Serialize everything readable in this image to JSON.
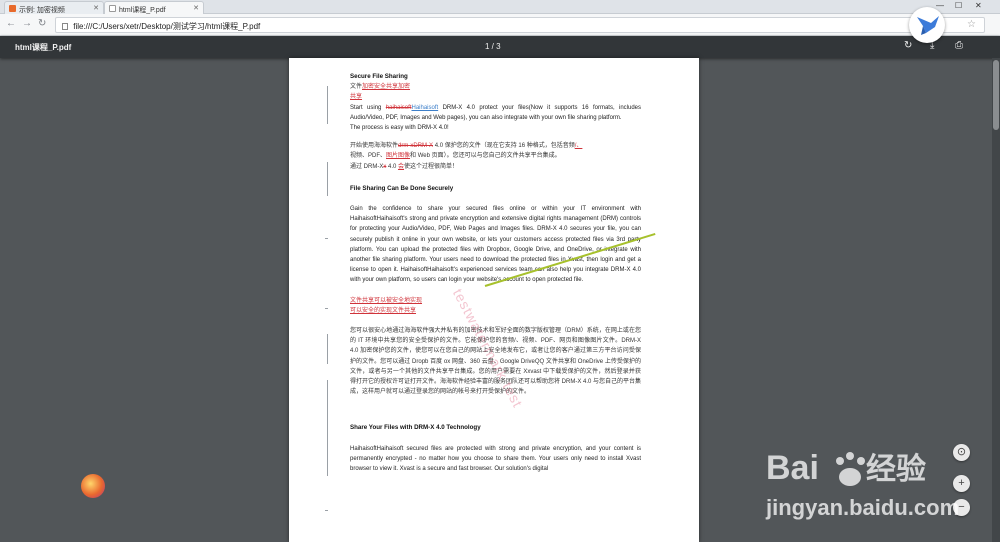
{
  "tabs": [
    {
      "title": "示例: 加密视频",
      "active": false
    },
    {
      "title": "html课程_P.pdf",
      "active": true
    }
  ],
  "address": {
    "url": "file:///C:/Users/xetr/Desktop/测试学习/html课程_P.pdf"
  },
  "pdf": {
    "file_name": "html课程_P.pdf",
    "page_indicator": "1 / 3"
  },
  "doc": {
    "h1": "Secure File Sharing",
    "cn_title_a": "文件",
    "cn_title_b": "加密安全共享加密",
    "cn_title_c": "共享",
    "p1_a": "Start using",
    "p1_strike": "haihaisoft",
    "p1_link": "Haihaisoft",
    "p1_b": "DRM-X 4.0 protect your files(Now it supports 16 formats, includes Audio/Video, PDF, Images and Web pages), you can also integrate with your own file sharing platform.",
    "p1_c": "The process is easy with DRM-X 4.0!",
    "cn1": "开始使用海海软件",
    "cn1_red": "drm-xDRM-X",
    "cn1_b": "4.0 保护您的文件（现在它支持 16 种格式，包括音频",
    "cn1_red2": "/、",
    "cn1_c": "视频、PDF、",
    "cn1_red3": "图片图像",
    "cn1_d": "和 Web 页面）。您还可以与您自己的文件共享平台集成。",
    "cn1_e": "通过 DRM-X",
    "cn1_red4": "x",
    "cn1_f": " 4.0 ",
    "cn1_red5": "会",
    "cn1_g": "使这个过程很简单！",
    "h2": "File Sharing Can Be Done Securely",
    "p2": "Gain the confidence to share your secured files online or within your IT environment with HaihaisoftHaihaisoft's strong and private encryption and extensive digital rights management (DRM) controls for protecting your Audio/Video, PDF, Web Pages and Images files. DRM-X 4.0 secures your file, you can securely publish it online in your own website, or lets your customers access protected files via 3rd party platform. You can upload the protected files with Dropbox, Google Drive, and OneDrive, or integrate with another file sharing platform. Your users need to download the protected files in Xvast, then login and get a license to open it. HaihaisoftHaihaisoft's experienced services team can also help you integrate DRM-X 4.0 with your own platform, so users can login your website's account to open protected file.",
    "cn2_t1": "文件共享可以被安全地实现",
    "cn2_t2": "可以安全的实现文件共享",
    "cn2": "您可以很安心地通过海海软件强大并私有的加密技术和军好全面的数字版权管理（DRM）系统，在网上或在您的 IT 环境中共享您的安全受保护的文件。它能保护您的音频/、视频、PDF、网页和图像图片文件。DRM-X 4.0 加密保护您的文件，使您可以在您自己的网站上安全地发布它，或者让您的客户通过第三方平台访问受保护的文件。您可以通过 Dropb 百度 ox 网盘、360 云盘、Google DriveQQ 文件共享和 OneDrive 上传受保护的文件，或者与另一个其他的文件共享平台集成。您的用户需要在 Xxvast 中下载受保护的文件，然后登录并获得打开它的授权许可证打开文件。海海软件经验丰富的服务团队还可以帮助您将 DRM-X 4.0 与您自己的平台集成，这样用户就可以通过登录您的网站的帐号来打开受保护的文件。",
    "h3": "Share Your Files with DRM-X 4.0 Technology",
    "p3": "HaihaisoftHaihaisoft secured files are protected with strong and private encryption, and your content is permanently encrypted - no matter how you choose to share them. Your users only need to install Xvast browser to view it. Xvast is a secure and fast browser. Our solution's digital",
    "watermark": "testwatermark test",
    "strike_words": [
      "haihaisoft",
      "drm-x",
      "x",
      "ox"
    ]
  },
  "zoom": {
    "fit": "⊙",
    "plus": "+",
    "minus": "−"
  },
  "branding": {
    "baidu_text": "Bai  经验",
    "baidu_url": "jingyan.baidu.com"
  },
  "colors": {
    "pdf_toolbar": "#323639",
    "viewer_bg": "#525659",
    "markup_red": "#d0333a",
    "link_blue": "#3d7fc9"
  }
}
